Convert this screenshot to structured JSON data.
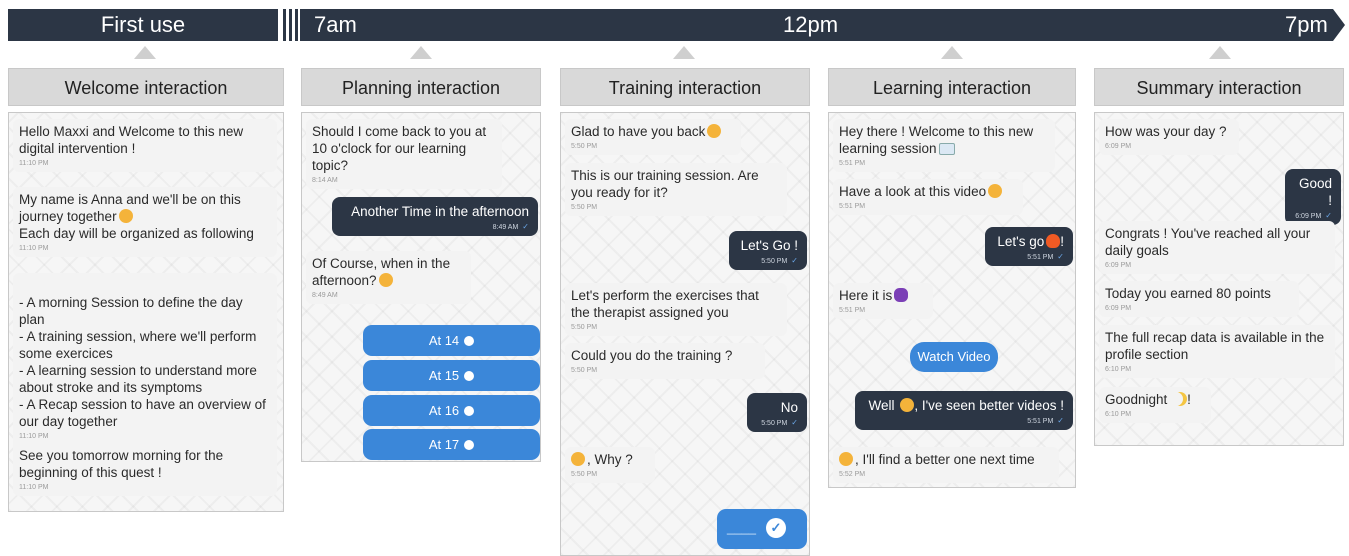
{
  "timeline": {
    "first_use": "First use",
    "t_7am": "7am",
    "t_12pm": "12pm",
    "t_7pm": "7pm"
  },
  "panels": {
    "welcome": {
      "title": "Welcome interaction",
      "m1": "Hello Maxxi and Welcome to this new digital intervention !",
      "m1_time": "11:10 PM",
      "m2a": "My name is Anna and we'll be on this journey together",
      "m2b": "Each day will be organized as following",
      "m2_time": "11:10 PM",
      "m3": "- A morning Session to define the day plan\n- A training session, where we'll perform some exercices\n- A learning session to understand more about stroke and its symptoms\n- A Recap session to have an overview of our day together",
      "m3_time": "11:10 PM",
      "m4": "See you tomorrow morning for the beginning of this quest !",
      "m4_time": "11:10 PM"
    },
    "planning": {
      "title": "Planning interaction",
      "m1": "Should I come back to you at 10 o'clock for our learning topic?",
      "m1_time": "8:14 AM",
      "reply": "Another Time in the afternoon",
      "reply_time": "8:49 AM",
      "m2": "Of Course, when in the afternoon?",
      "m2_time": "8:49 AM",
      "options": [
        "At 14",
        "At 15",
        "At 16",
        "At 17"
      ]
    },
    "training": {
      "title": "Training interaction",
      "m1": "Glad to have you back",
      "m1_time": "5:50 PM",
      "m2": "This is our training session. Are you ready for it?",
      "m2_time": "5:50 PM",
      "reply1": "Let's Go !",
      "reply1_time": "5:50 PM",
      "m3": "Let's perform the exercises that the therapist assigned you",
      "m3_time": "5:50 PM",
      "m4": "Could you do the training ?",
      "m4_time": "5:50 PM",
      "reply2": "No",
      "reply2_time": "5:50 PM",
      "m5": ", Why ?",
      "m5_time": "5:50 PM",
      "input_value": "____"
    },
    "learning": {
      "title": "Learning interaction",
      "m1": "Hey there ! Welcome to this new learning session",
      "m1_time": "5:51 PM",
      "m2": "Have a look at this video",
      "m2_time": "5:51 PM",
      "reply1": "Let's go",
      "reply1_suffix": "!",
      "reply1_time": "5:51 PM",
      "m3": "Here it is",
      "m3_time": "5:51 PM",
      "button": "Watch Video",
      "reply2a": "Well",
      "reply2b": ", I've seen better videos !",
      "reply2_time": "5:51 PM",
      "m4": ", I'll find a better one next time",
      "m4_time": "5:52 PM"
    },
    "summary": {
      "title": "Summary interaction",
      "m1": "How was your day ?",
      "m1_time": "6:09 PM",
      "reply": "Good !",
      "reply_time": "6:09 PM",
      "m2": "Congrats ! You've reached all your daily goals",
      "m2_time": "6:09 PM",
      "m3": "Today you earned 80 points",
      "m3_time": "6:09 PM",
      "m4": "The full recap data is available in the profile section",
      "m4_time": "6:10 PM",
      "m5": "Goodnight",
      "m5_suffix": "!",
      "m5_time": "6:10 PM"
    }
  },
  "colors": {
    "dark": "#2c3645",
    "blue": "#3b87d9",
    "header": "#d9d9d9"
  }
}
